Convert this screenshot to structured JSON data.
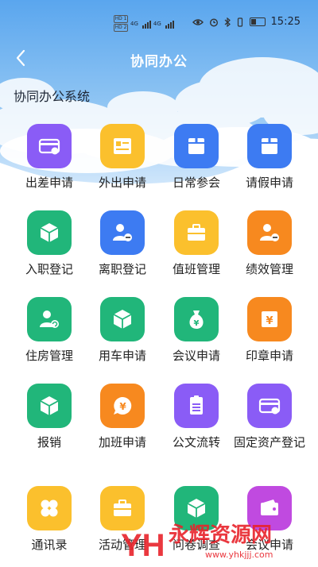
{
  "status_bar": {
    "hd_top": "HD 1",
    "hd_bottom": "HD 2",
    "signal_1": "4G",
    "signal_2": "4G",
    "time": "15:25",
    "icons": [
      "eye-icon",
      "alarm-icon",
      "bluetooth-icon",
      "vibrate-icon",
      "battery-icon"
    ]
  },
  "header": {
    "back_icon": "chevron-left-icon",
    "title": "协同办公"
  },
  "section": {
    "title": "协同办公系统"
  },
  "colors": {
    "purple": "#8a5cf6",
    "yellow": "#fbc02d",
    "blue": "#3d7bf2",
    "green": "#21b67a",
    "orange": "#f7891f",
    "magenta": "#c04ae0",
    "title_white": "#ffffff"
  },
  "apps": [
    {
      "label": "出差申请",
      "icon": "travel-card-icon",
      "color": "purple"
    },
    {
      "label": "外出申请",
      "icon": "id-card-icon",
      "color": "yellow"
    },
    {
      "label": "日常参会",
      "icon": "box-icon",
      "color": "blue"
    },
    {
      "label": "请假申请",
      "icon": "box-icon",
      "color": "blue"
    },
    {
      "label": "入职登记",
      "icon": "cube-icon",
      "color": "green"
    },
    {
      "label": "离职登记",
      "icon": "user-remove-icon",
      "color": "blue"
    },
    {
      "label": "值班管理",
      "icon": "briefcase-icon",
      "color": "yellow"
    },
    {
      "label": "绩效管理",
      "icon": "user-remove-icon",
      "color": "orange"
    },
    {
      "label": "住房管理",
      "icon": "user-refresh-icon",
      "color": "green"
    },
    {
      "label": "用车申请",
      "icon": "cube-icon",
      "color": "green"
    },
    {
      "label": "会议申请",
      "icon": "money-bag-icon",
      "color": "green"
    },
    {
      "label": "印章申请",
      "icon": "yen-square-icon",
      "color": "orange"
    },
    {
      "label": "报销",
      "icon": "cube-icon",
      "color": "green"
    },
    {
      "label": "加班申请",
      "icon": "yen-chat-icon",
      "color": "orange"
    },
    {
      "label": "公文流转",
      "icon": "document-icon",
      "color": "purple"
    },
    {
      "label": "固定资产登记",
      "icon": "travel-card-icon",
      "color": "purple"
    },
    {
      "label": "通讯录",
      "icon": "clover-icon",
      "color": "yellow"
    },
    {
      "label": "活动管理",
      "icon": "briefcase-icon",
      "color": "yellow"
    },
    {
      "label": "问卷调查",
      "icon": "cube-icon",
      "color": "green"
    },
    {
      "label": "会议申请",
      "icon": "wallet-icon",
      "color": "magenta"
    }
  ],
  "watermark": {
    "main": "永辉资源网",
    "sub": "www.yhkjjj.com",
    "logo": "YH"
  }
}
